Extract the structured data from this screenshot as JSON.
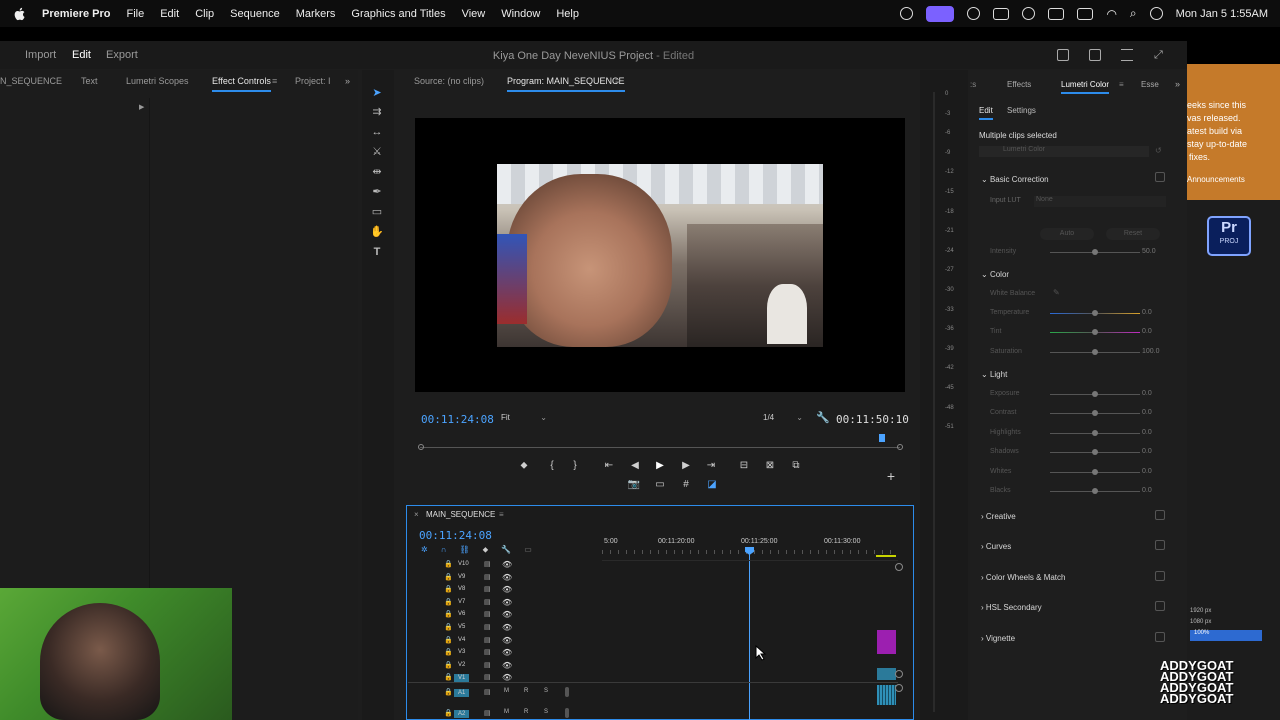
{
  "menubar": {
    "app": "Premiere Pro",
    "items": [
      "File",
      "Edit",
      "Clip",
      "Sequence",
      "Markers",
      "Graphics and Titles",
      "View",
      "Window",
      "Help"
    ],
    "clock": "Mon Jan 5  1:55AM"
  },
  "header": {
    "tabs": [
      "Import",
      "Edit",
      "Export"
    ],
    "active_tab": "Edit",
    "project_title": "Kiya One Day NeveNIUS Project",
    "edited_label": " - Edited"
  },
  "left_panel": {
    "tabs": [
      "N_SEQUENCE",
      "Text",
      "Lumetri Scopes",
      "Effect Controls",
      "Project: I"
    ],
    "active": "Effect Controls"
  },
  "source_panel": {
    "title": "Source: (no clips)"
  },
  "program_panel": {
    "title": "Program: MAIN_SEQUENCE",
    "timecode_current": "00:11:24:08",
    "fit": "Fit",
    "quality": "1/4",
    "timecode_end": "00:11:50:10"
  },
  "timeline": {
    "sequence_name": "MAIN_SEQUENCE",
    "timecode": "00:11:24:08",
    "ruler": [
      "5:00",
      "00:11:20:00",
      "00:11:25:00",
      "00:11:30:00"
    ],
    "video_tracks": [
      "V10",
      "V9",
      "V8",
      "V7",
      "V6",
      "V5",
      "V4",
      "V3",
      "V2",
      "V1"
    ],
    "audio_tracks": [
      "A1",
      "A2"
    ],
    "audio_btns": [
      "M",
      "R",
      "S"
    ]
  },
  "lumetri": {
    "tabs": [
      "Effects",
      "Lumetri Color",
      "Esse"
    ],
    "subtabs": [
      "Edit",
      "Settings"
    ],
    "clips_label": "Multiple clips selected",
    "effect_dropdown": "Lumetri Color",
    "basic": "Basic Correction",
    "input_lut_label": "Input LUT",
    "input_lut_value": "None",
    "auto": "Auto",
    "reset": "Reset",
    "intensity": {
      "label": "Intensity",
      "value": "50.0"
    },
    "color_section": "Color",
    "white_balance": "White Balance",
    "color_sliders": [
      {
        "label": "Temperature",
        "value": "0.0"
      },
      {
        "label": "Tint",
        "value": "0.0"
      },
      {
        "label": "Saturation",
        "value": "100.0"
      }
    ],
    "light_section": "Light",
    "light_sliders": [
      {
        "label": "Exposure",
        "value": "0.0"
      },
      {
        "label": "Contrast",
        "value": "0.0"
      },
      {
        "label": "Highlights",
        "value": "0.0"
      },
      {
        "label": "Shadows",
        "value": "0.0"
      },
      {
        "label": "Whites",
        "value": "0.0"
      },
      {
        "label": "Blacks",
        "value": "0.0"
      }
    ],
    "sections": [
      "Creative",
      "Curves",
      "Color Wheels & Match",
      "HSL Secondary",
      "Vignette"
    ]
  },
  "meter_labels": [
    "0",
    "-3",
    "-6",
    "-9",
    "-12",
    "-15",
    "-18",
    "-21",
    "-24",
    "-27",
    "-30",
    "-33",
    "-36",
    "-39",
    "-42",
    "-45",
    "-48",
    "-51"
  ],
  "overlay_right": {
    "lines": [
      "eeks since this",
      "vas released.",
      "atest build via",
      "stay up-to-date",
      "fixes."
    ],
    "link": "Announcements",
    "pr_label": "Pr",
    "proj_label": "PROJ",
    "px1": "1920 px",
    "px2": "1080 px",
    "pct": "100%"
  },
  "watermark": [
    "ADDYGOAT",
    "ADDYGOAT",
    "ADDYGOAT",
    "ADDYGOAT"
  ]
}
